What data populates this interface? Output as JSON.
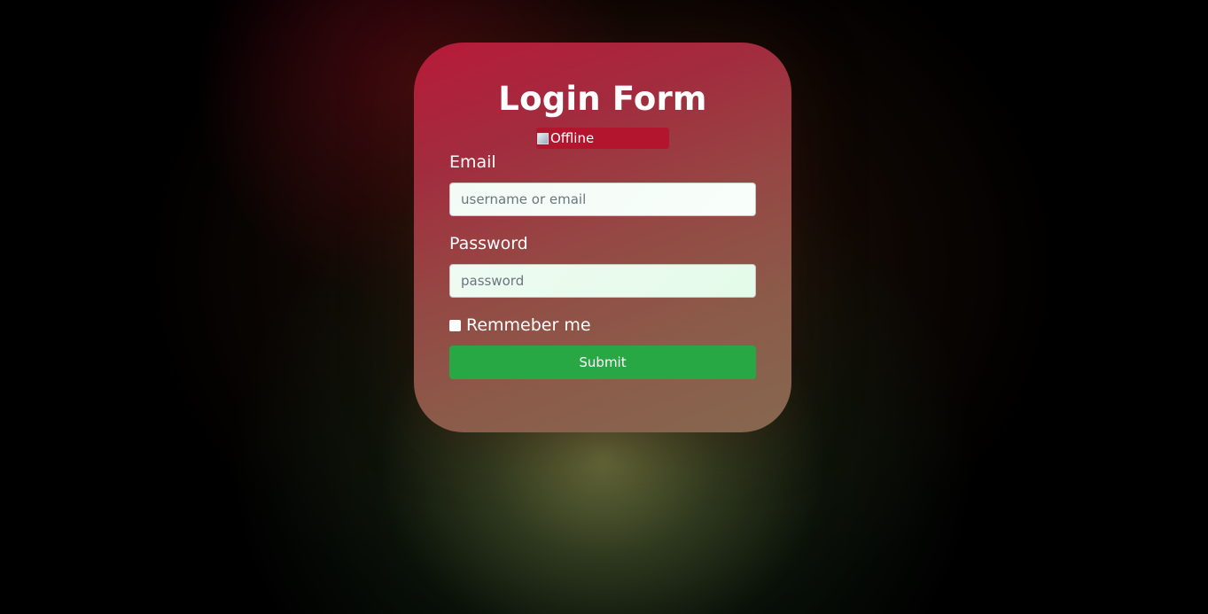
{
  "form": {
    "title": "Login Form",
    "status_image_alt": "Offline",
    "email_label": "Email",
    "email_placeholder": "username or email",
    "email_value": "",
    "password_label": "Password",
    "password_placeholder": "password",
    "password_value": "",
    "remember_label": "Remmeber me",
    "remember_checked": false,
    "submit_label": "Submit"
  },
  "colors": {
    "background": "#000000",
    "card_top": "#b81a38",
    "card_bottom": "#86674f",
    "status_bg": "#b3152f",
    "submit_bg": "#28a745",
    "text": "#ffffff"
  },
  "icons": {
    "status": "broken-image-icon"
  }
}
